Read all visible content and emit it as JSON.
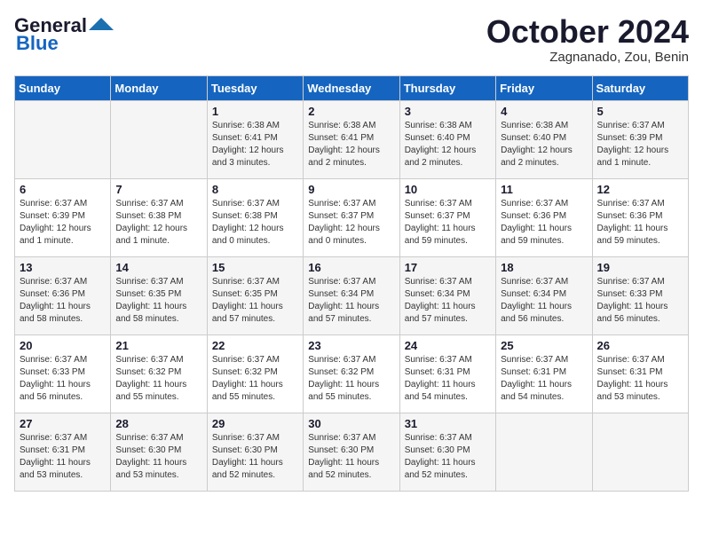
{
  "header": {
    "logo_line1": "General",
    "logo_line2": "Blue",
    "month_title": "October 2024",
    "subtitle": "Zagnanado, Zou, Benin"
  },
  "weekdays": [
    "Sunday",
    "Monday",
    "Tuesday",
    "Wednesday",
    "Thursday",
    "Friday",
    "Saturday"
  ],
  "weeks": [
    [
      {
        "day": "",
        "info": ""
      },
      {
        "day": "",
        "info": ""
      },
      {
        "day": "1",
        "info": "Sunrise: 6:38 AM\nSunset: 6:41 PM\nDaylight: 12 hours\nand 3 minutes."
      },
      {
        "day": "2",
        "info": "Sunrise: 6:38 AM\nSunset: 6:41 PM\nDaylight: 12 hours\nand 2 minutes."
      },
      {
        "day": "3",
        "info": "Sunrise: 6:38 AM\nSunset: 6:40 PM\nDaylight: 12 hours\nand 2 minutes."
      },
      {
        "day": "4",
        "info": "Sunrise: 6:38 AM\nSunset: 6:40 PM\nDaylight: 12 hours\nand 2 minutes."
      },
      {
        "day": "5",
        "info": "Sunrise: 6:37 AM\nSunset: 6:39 PM\nDaylight: 12 hours\nand 1 minute."
      }
    ],
    [
      {
        "day": "6",
        "info": "Sunrise: 6:37 AM\nSunset: 6:39 PM\nDaylight: 12 hours\nand 1 minute."
      },
      {
        "day": "7",
        "info": "Sunrise: 6:37 AM\nSunset: 6:38 PM\nDaylight: 12 hours\nand 1 minute."
      },
      {
        "day": "8",
        "info": "Sunrise: 6:37 AM\nSunset: 6:38 PM\nDaylight: 12 hours\nand 0 minutes."
      },
      {
        "day": "9",
        "info": "Sunrise: 6:37 AM\nSunset: 6:37 PM\nDaylight: 12 hours\nand 0 minutes."
      },
      {
        "day": "10",
        "info": "Sunrise: 6:37 AM\nSunset: 6:37 PM\nDaylight: 11 hours\nand 59 minutes."
      },
      {
        "day": "11",
        "info": "Sunrise: 6:37 AM\nSunset: 6:36 PM\nDaylight: 11 hours\nand 59 minutes."
      },
      {
        "day": "12",
        "info": "Sunrise: 6:37 AM\nSunset: 6:36 PM\nDaylight: 11 hours\nand 59 minutes."
      }
    ],
    [
      {
        "day": "13",
        "info": "Sunrise: 6:37 AM\nSunset: 6:36 PM\nDaylight: 11 hours\nand 58 minutes."
      },
      {
        "day": "14",
        "info": "Sunrise: 6:37 AM\nSunset: 6:35 PM\nDaylight: 11 hours\nand 58 minutes."
      },
      {
        "day": "15",
        "info": "Sunrise: 6:37 AM\nSunset: 6:35 PM\nDaylight: 11 hours\nand 57 minutes."
      },
      {
        "day": "16",
        "info": "Sunrise: 6:37 AM\nSunset: 6:34 PM\nDaylight: 11 hours\nand 57 minutes."
      },
      {
        "day": "17",
        "info": "Sunrise: 6:37 AM\nSunset: 6:34 PM\nDaylight: 11 hours\nand 57 minutes."
      },
      {
        "day": "18",
        "info": "Sunrise: 6:37 AM\nSunset: 6:34 PM\nDaylight: 11 hours\nand 56 minutes."
      },
      {
        "day": "19",
        "info": "Sunrise: 6:37 AM\nSunset: 6:33 PM\nDaylight: 11 hours\nand 56 minutes."
      }
    ],
    [
      {
        "day": "20",
        "info": "Sunrise: 6:37 AM\nSunset: 6:33 PM\nDaylight: 11 hours\nand 56 minutes."
      },
      {
        "day": "21",
        "info": "Sunrise: 6:37 AM\nSunset: 6:32 PM\nDaylight: 11 hours\nand 55 minutes."
      },
      {
        "day": "22",
        "info": "Sunrise: 6:37 AM\nSunset: 6:32 PM\nDaylight: 11 hours\nand 55 minutes."
      },
      {
        "day": "23",
        "info": "Sunrise: 6:37 AM\nSunset: 6:32 PM\nDaylight: 11 hours\nand 55 minutes."
      },
      {
        "day": "24",
        "info": "Sunrise: 6:37 AM\nSunset: 6:31 PM\nDaylight: 11 hours\nand 54 minutes."
      },
      {
        "day": "25",
        "info": "Sunrise: 6:37 AM\nSunset: 6:31 PM\nDaylight: 11 hours\nand 54 minutes."
      },
      {
        "day": "26",
        "info": "Sunrise: 6:37 AM\nSunset: 6:31 PM\nDaylight: 11 hours\nand 53 minutes."
      }
    ],
    [
      {
        "day": "27",
        "info": "Sunrise: 6:37 AM\nSunset: 6:31 PM\nDaylight: 11 hours\nand 53 minutes."
      },
      {
        "day": "28",
        "info": "Sunrise: 6:37 AM\nSunset: 6:30 PM\nDaylight: 11 hours\nand 53 minutes."
      },
      {
        "day": "29",
        "info": "Sunrise: 6:37 AM\nSunset: 6:30 PM\nDaylight: 11 hours\nand 52 minutes."
      },
      {
        "day": "30",
        "info": "Sunrise: 6:37 AM\nSunset: 6:30 PM\nDaylight: 11 hours\nand 52 minutes."
      },
      {
        "day": "31",
        "info": "Sunrise: 6:37 AM\nSunset: 6:30 PM\nDaylight: 11 hours\nand 52 minutes."
      },
      {
        "day": "",
        "info": ""
      },
      {
        "day": "",
        "info": ""
      }
    ]
  ]
}
